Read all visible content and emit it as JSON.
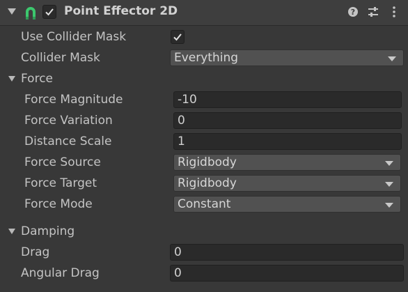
{
  "header": {
    "title": "Point Effector 2D",
    "enabled": true,
    "component_icon": "magnet-icon",
    "help_icon": "help-icon",
    "presets_icon": "sliders-icon",
    "menu_icon": "kebab-menu-icon"
  },
  "use_collider_mask": {
    "label": "Use Collider Mask",
    "checked": true
  },
  "collider_mask": {
    "label": "Collider Mask",
    "value": "Everything"
  },
  "force": {
    "label": "Force",
    "magnitude": {
      "label": "Force Magnitude",
      "value": "-10"
    },
    "variation": {
      "label": "Force Variation",
      "value": "0"
    },
    "distance_scale": {
      "label": "Distance Scale",
      "value": "1"
    },
    "source": {
      "label": "Force Source",
      "value": "Rigidbody"
    },
    "target": {
      "label": "Force Target",
      "value": "Rigidbody"
    },
    "mode": {
      "label": "Force Mode",
      "value": "Constant"
    }
  },
  "damping": {
    "label": "Damping",
    "drag": {
      "label": "Drag",
      "value": "0"
    },
    "angular_drag": {
      "label": "Angular Drag",
      "value": "0"
    }
  },
  "colors": {
    "background": "#383838",
    "header": "#3e3e3e",
    "field": "#2a2a2a",
    "dropdown": "#515151",
    "icon_green": "#3cc86e"
  }
}
